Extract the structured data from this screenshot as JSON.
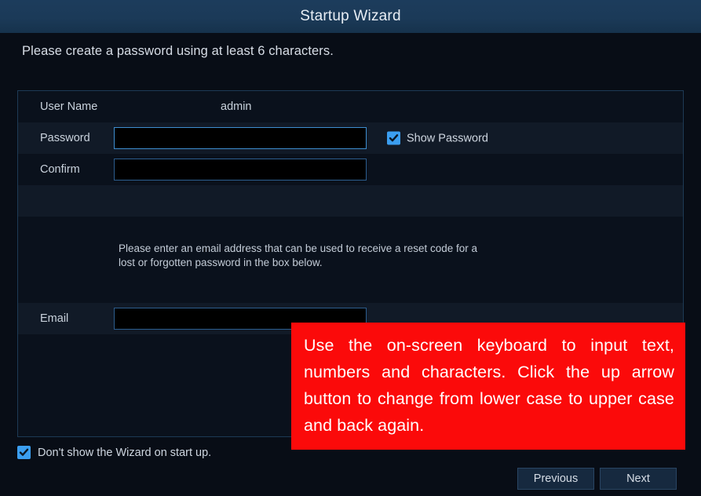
{
  "window": {
    "title": "Startup Wizard"
  },
  "headline": "Please create a password using at least 6 characters.",
  "form": {
    "rows": {
      "username": {
        "label": "User Name",
        "value": "admin"
      },
      "password": {
        "label": "Password",
        "value": ""
      },
      "confirm": {
        "label": "Confirm",
        "value": ""
      },
      "email": {
        "label": "Email",
        "value": ""
      }
    },
    "show_password": {
      "label": "Show Password",
      "checked": true
    }
  },
  "note": "Please enter an email address that can be used to receive a reset code for a lost or forgotten password in the box below.",
  "footer": {
    "dont_show": {
      "label": "Don't show the Wizard on start up.",
      "checked": true
    },
    "previous_label": "Previous",
    "next_label": "Next"
  },
  "annotation": {
    "text": "Use the on-screen keyboard to input text, numbers and characters. Click the up arrow button to change from lower case to upper case and back again."
  },
  "colors": {
    "titlebar": "#1b3a58",
    "body": "#080d16",
    "accent_blue": "#3b9ef0",
    "annotation_red": "#fb0a0a",
    "field_border": "#3e8ed0"
  }
}
